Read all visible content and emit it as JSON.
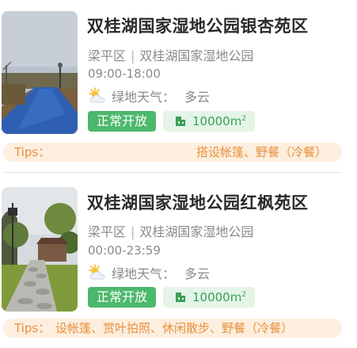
{
  "parks": [
    {
      "name": "双桂湖国家湿地公园银杏苑区",
      "district": "梁平区",
      "park": "双桂湖国家湿地公园",
      "hours": "09:00-18:00",
      "weather_label": "绿地天气：",
      "weather_value": "多云",
      "weather_icon": "partly-cloudy-icon",
      "status": "正常开放",
      "area": "10000m",
      "area_unit_sup": "2",
      "tips_label": "Tips：",
      "tips_text": "搭设帐篷、野餐（冷餐）"
    },
    {
      "name": "双桂湖国家湿地公园红枫苑区",
      "district": "梁平区",
      "park": "双桂湖国家湿地公园",
      "hours": "00:00-23:59",
      "weather_label": "绿地天气：",
      "weather_value": "多云",
      "weather_icon": "partly-cloudy-icon",
      "status": "正常开放",
      "area": "10000m",
      "area_unit_sup": "2",
      "tips_label": "Tips：",
      "tips_text": "设帐篷、赏叶拍照、休闲散步、野餐（冷餐）"
    }
  ],
  "separator": "|",
  "colors": {
    "open_badge": "#4bb86b",
    "area_badge_bg": "#e4f5e8",
    "tips_bg": "#fdeede",
    "tips_text": "#e6913e"
  }
}
